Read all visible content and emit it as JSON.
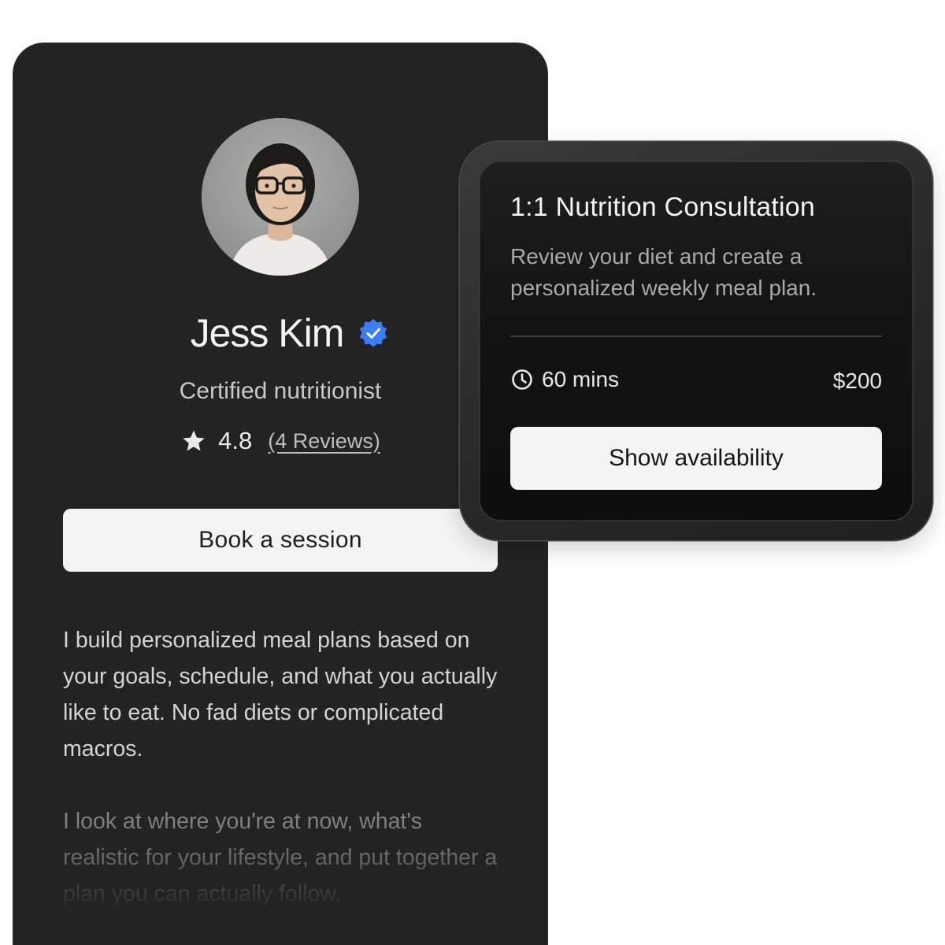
{
  "profile": {
    "name": "Jess Kim",
    "verified_icon": "verified-badge-icon",
    "title": "Certified nutritionist",
    "rating": "4.8",
    "rating_icon": "star-icon",
    "reviews_label": "(4 Reviews)",
    "book_button_label": "Book a session",
    "bio_paragraphs": [
      "I build personalized meal plans based on your goals, schedule, and what you actually like to eat. No fad diets or complicated macros.",
      "I look at where you're at now, what's realistic for your lifestyle, and put together a plan you can actually follow."
    ]
  },
  "consultation": {
    "title": "1:1 Nutrition Consultation",
    "description": "Review your diet and create a personalized weekly meal plan.",
    "duration_icon": "clock-icon",
    "duration": "60 mins",
    "price": "$200",
    "button_label": "Show availability"
  },
  "colors": {
    "card_background": "#232323",
    "verified_badge": "#3b7df2",
    "button_background": "#f4f4f4"
  }
}
